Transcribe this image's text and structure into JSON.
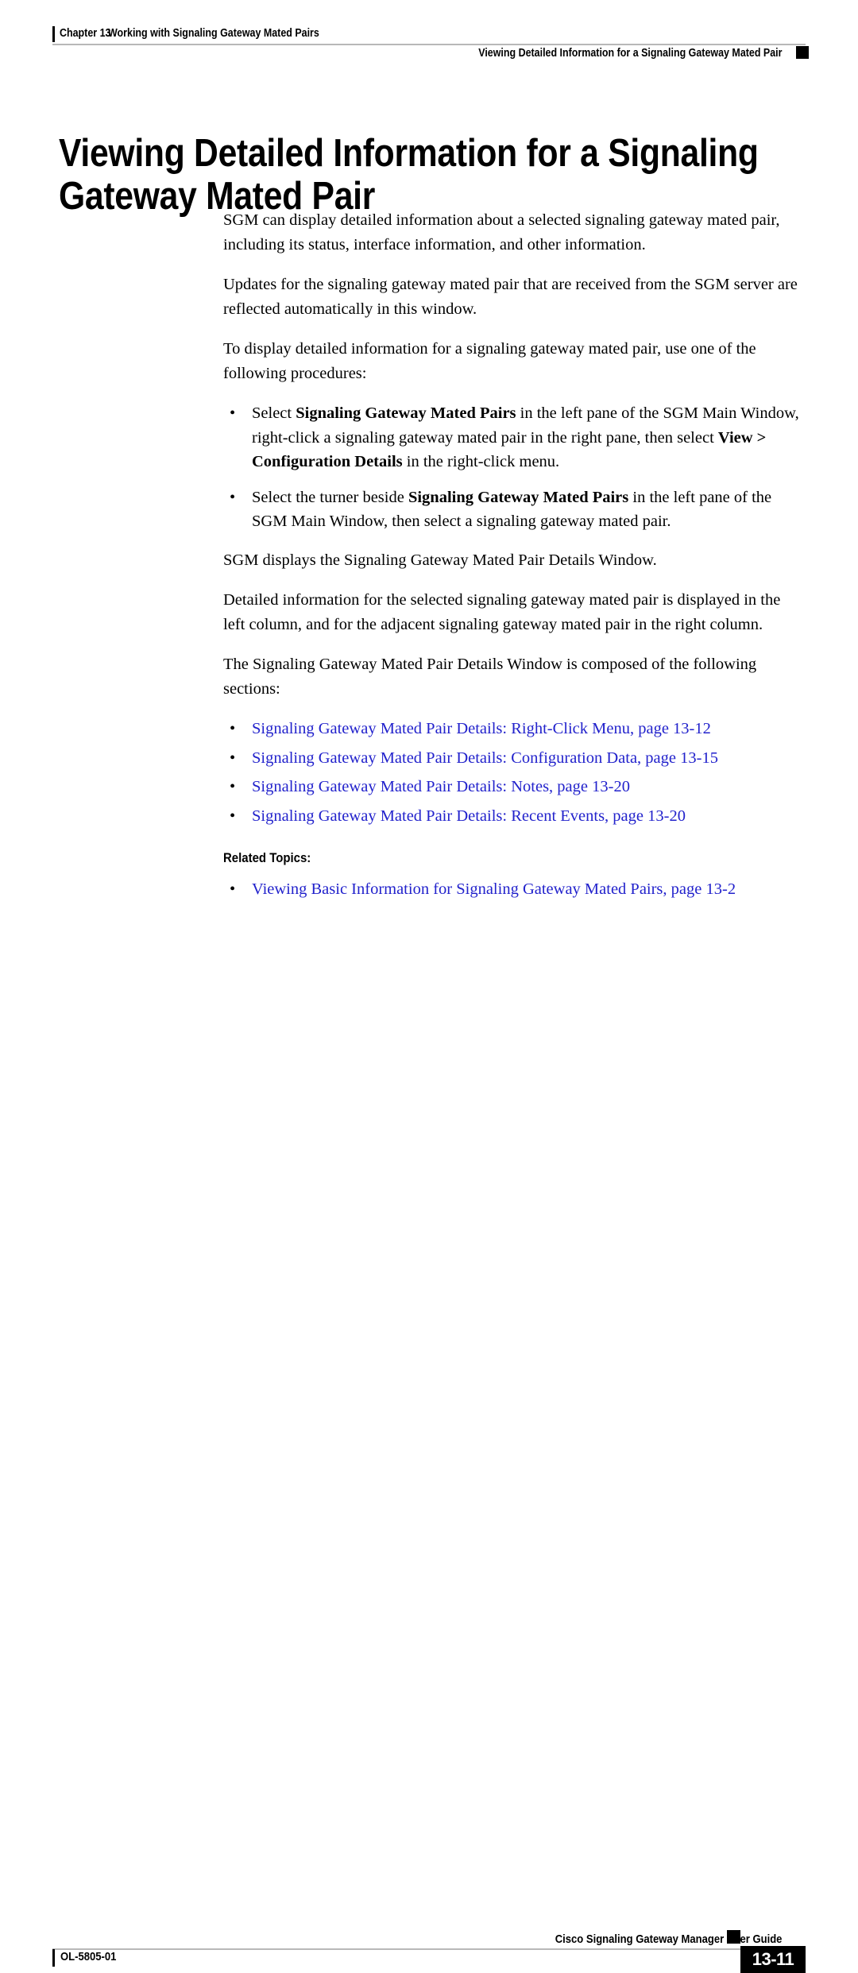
{
  "header": {
    "chapter_label": "Chapter 13",
    "chapter_title": "Working with Signaling Gateway Mated Pairs",
    "section_title": "Viewing Detailed Information for a Signaling Gateway Mated Pair"
  },
  "title": "Viewing Detailed Information for a Signaling Gateway Mated Pair",
  "body": {
    "para1": "SGM can display detailed information about a selected signaling gateway mated pair, including its status, interface information, and other information.",
    "para2": "Updates for the signaling gateway mated pair that are received from the SGM server are reflected automatically in this window.",
    "para3": "To display detailed information for a signaling gateway mated pair, use one of the following procedures:",
    "bullet1": {
      "seg1": "Select ",
      "bold1": "Signaling Gateway Mated Pairs",
      "seg2": " in the left pane of the SGM Main Window, right-click a signaling gateway mated pair in the right pane, then select ",
      "bold2": "View > Configuration Details",
      "seg3": " in the right-click menu."
    },
    "bullet2": {
      "seg1": "Select the turner beside ",
      "bold1": "Signaling Gateway Mated Pairs",
      "seg2": " in the left pane of the SGM Main Window, then select a signaling gateway mated pair."
    },
    "para4": "SGM displays the Signaling Gateway Mated Pair Details Window.",
    "para5": "Detailed information for the selected signaling gateway mated pair is displayed in the left column, and for the adjacent signaling gateway mated pair in the right column.",
    "para6": "The Signaling Gateway Mated Pair Details Window is composed of the following sections:",
    "section_links": [
      "Signaling Gateway Mated Pair Details: Right-Click Menu, page 13-12",
      "Signaling Gateway Mated Pair Details: Configuration Data, page 13-15",
      "Signaling Gateway Mated Pair Details: Notes, page 13-20",
      "Signaling Gateway Mated Pair Details: Recent Events, page 13-20"
    ],
    "related_topics_heading": "Related Topics:",
    "related_links": [
      "Viewing Basic Information for Signaling Gateway Mated Pairs, page 13-2"
    ]
  },
  "footer": {
    "guide_title": "Cisco Signaling Gateway Manager User Guide",
    "doc_id": "OL-5805-01",
    "page_number": "13-11"
  },
  "colors": {
    "link": "#2222cc",
    "rule": "#b8b8b8",
    "text": "#000000",
    "page_box_bg": "#000000"
  },
  "bullet_glyph": "•"
}
